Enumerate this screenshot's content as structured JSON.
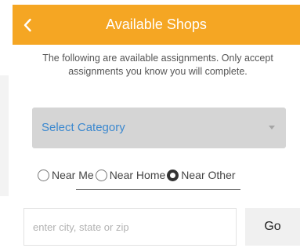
{
  "colors": {
    "header_bg": "#f5a623",
    "header_text": "#ffffff",
    "select_bg": "#d5d5d5",
    "select_text": "#3b88cf",
    "go_bg": "#f0f0f0"
  },
  "header": {
    "back_icon": "chevron-left-icon",
    "title": "Available Shops"
  },
  "intro": {
    "text": "The following are available assignments. Only accept assignments you know you will complete."
  },
  "category_select": {
    "selected_label": "Select Category",
    "caret_icon": "caret-down-icon"
  },
  "location_filter": {
    "options": [
      {
        "label": "Near Me",
        "checked": false
      },
      {
        "label": "Near Home",
        "checked": false
      },
      {
        "label": "Near Other",
        "checked": true
      }
    ]
  },
  "location_search": {
    "value": "",
    "placeholder": "enter city, state or zip",
    "go_label": "Go"
  }
}
